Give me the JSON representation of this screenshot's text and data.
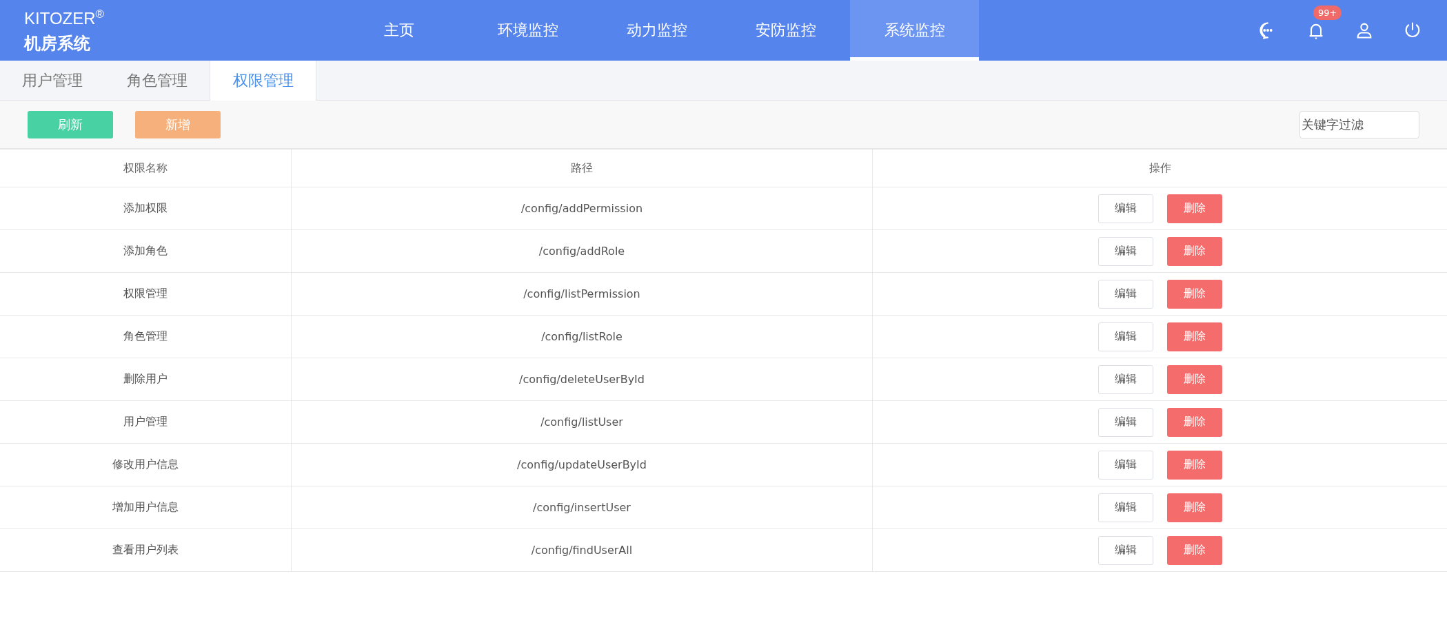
{
  "brand": {
    "name": "KITOZER",
    "mark": "®",
    "subtitle": "机房系统"
  },
  "nav": [
    {
      "label": "主页",
      "selected": false
    },
    {
      "label": "环境监控",
      "selected": false
    },
    {
      "label": "动力监控",
      "selected": false
    },
    {
      "label": "安防监控",
      "selected": false
    },
    {
      "label": "系统监控",
      "selected": true
    }
  ],
  "header_icons": {
    "notification_badge": "99+"
  },
  "tabs": [
    {
      "label": "用户管理",
      "selected": false
    },
    {
      "label": "角色管理",
      "selected": false
    },
    {
      "label": "权限管理",
      "selected": true
    }
  ],
  "toolbar": {
    "buttons": [
      {
        "label": "刷新",
        "kind": "refresh"
      },
      {
        "label": "新增",
        "kind": "add"
      }
    ],
    "filter": {
      "placeholder": "关键字过滤"
    }
  },
  "table": {
    "columns": [
      "权限名称",
      "路径",
      "操作"
    ],
    "rows": [
      {
        "name": "添加权限",
        "path": "/config/addPermission",
        "edit": "编辑",
        "delete": "删除"
      },
      {
        "name": "添加角色",
        "path": "/config/addRole",
        "edit": "编辑",
        "delete": "删除"
      },
      {
        "name": "权限管理",
        "path": "/config/listPermission",
        "edit": "编辑",
        "delete": "删除"
      },
      {
        "name": "角色管理",
        "path": "/config/listRole",
        "edit": "编辑",
        "delete": "删除"
      },
      {
        "name": "删除用户",
        "path": "/config/deleteUserById",
        "edit": "编辑",
        "delete": "删除"
      },
      {
        "name": "用户管理",
        "path": "/config/listUser",
        "edit": "编辑",
        "delete": "删除"
      },
      {
        "name": "修改用户信息",
        "path": "/config/updateUserById",
        "edit": "编辑",
        "delete": "删除"
      },
      {
        "name": "增加用户信息",
        "path": "/config/insertUser",
        "edit": "编辑",
        "delete": "删除"
      },
      {
        "name": "查看用户列表",
        "path": "/config/findUserAll",
        "edit": "编辑",
        "delete": "删除"
      }
    ]
  }
}
